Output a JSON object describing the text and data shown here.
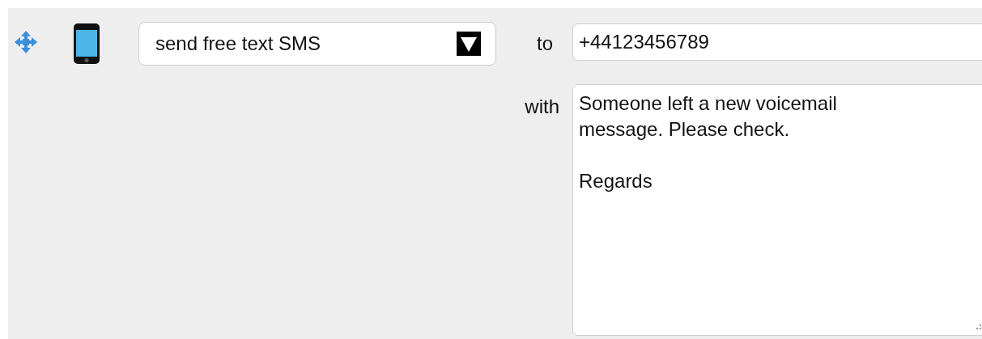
{
  "action": {
    "value": "send free text SMS"
  },
  "to": {
    "label": "to",
    "value": "+44123456789"
  },
  "with": {
    "label": "with",
    "value": "Someone left a new voicemail\nmessage. Please check.\n\nRegards"
  }
}
